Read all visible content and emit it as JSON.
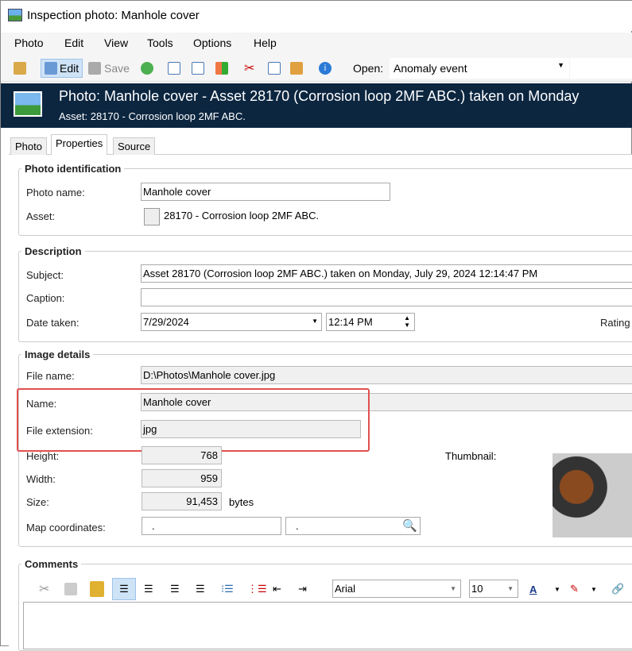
{
  "window": {
    "title": "Inspection photo: Manhole cover"
  },
  "menu": [
    "Photo",
    "Edit",
    "View",
    "Tools",
    "Options",
    "Help"
  ],
  "toolbar": {
    "edit": "Edit",
    "save": "Save",
    "open_label": "Open:",
    "open_value": "Anomaly event"
  },
  "header": {
    "title": "Photo: Manhole cover - Asset 28170 (Corrosion loop 2MF ABC.) taken on Monday",
    "subtitle": "Asset: 28170 - Corrosion loop 2MF ABC."
  },
  "tabs": [
    "Photo",
    "Properties",
    "Source"
  ],
  "photo_identification": {
    "title": "Photo identification",
    "name_label": "Photo name:",
    "name_value": "Manhole cover",
    "asset_label": "Asset:",
    "asset_value": "28170 - Corrosion loop 2MF ABC."
  },
  "description": {
    "title": "Description",
    "subject_label": "Subject:",
    "subject_value": "Asset 28170 (Corrosion loop 2MF ABC.) taken on Monday, July 29, 2024 12:14:47 PM",
    "caption_label": "Caption:",
    "caption_value": "",
    "date_label": "Date taken:",
    "date_value": "7/29/2024",
    "time_value": "12:14 PM",
    "rating_label": "Rating"
  },
  "image_details": {
    "title": "Image details",
    "file_name_label": "File name:",
    "file_name_value": "D:\\Photos\\Manhole cover.jpg",
    "name_label": "Name:",
    "name_value": "Manhole cover",
    "ext_label": "File extension:",
    "ext_value": "jpg",
    "height_label": "Height:",
    "height_value": "768",
    "width_label": "Width:",
    "width_value": "959",
    "size_label": "Size:",
    "size_value": "91,453",
    "size_unit": "bytes",
    "map_label": "Map coordinates:",
    "map_x": ".",
    "map_y": ".",
    "thumbnail_label": "Thumbnail:"
  },
  "comments": {
    "title": "Comments",
    "font": "Arial",
    "size": "10"
  }
}
